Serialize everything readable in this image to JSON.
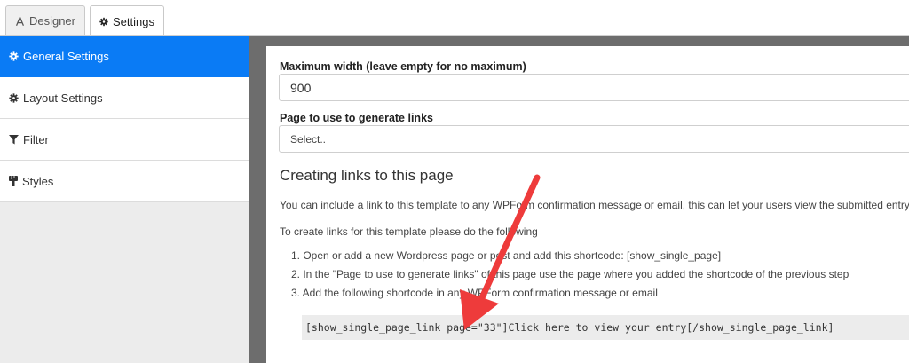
{
  "tabs": {
    "designer": "Designer",
    "settings": "Settings"
  },
  "sidebar": {
    "items": [
      {
        "label": "General Settings",
        "icon": "gear-icon",
        "active": true
      },
      {
        "label": "Layout Settings",
        "icon": "gear-icon",
        "active": false
      },
      {
        "label": "Filter",
        "icon": "filter-icon",
        "active": false
      },
      {
        "label": "Styles",
        "icon": "paint-brush-icon",
        "active": false
      }
    ]
  },
  "main": {
    "max_width_label": "Maximum width (leave empty for no maximum)",
    "max_width_value": "900",
    "page_label": "Page to use to generate links",
    "page_select_value": "Select..",
    "creating_heading": "Creating links to this page",
    "intro_text": "You can include a link to this template to any WPForm confirmation message or email, this can let your users view the submitted entry",
    "instructions_text": "To create links for this template please do the following",
    "steps": [
      "1. Open or add a new Wordpress page or post and add this shortcode: [show_single_page]",
      "2. In the \"Page to use to generate links\" of this page use the page where you added the shortcode of the previous step",
      "3. Add the following shortcode in any WPForm confirmation message or email"
    ],
    "shortcode": "[show_single_page_link page=\"33\"]Click here to view your entry[/show_single_page_link]"
  },
  "colors": {
    "accent": "#0a7bf5",
    "annotation_arrow": "#ee3b3b"
  }
}
